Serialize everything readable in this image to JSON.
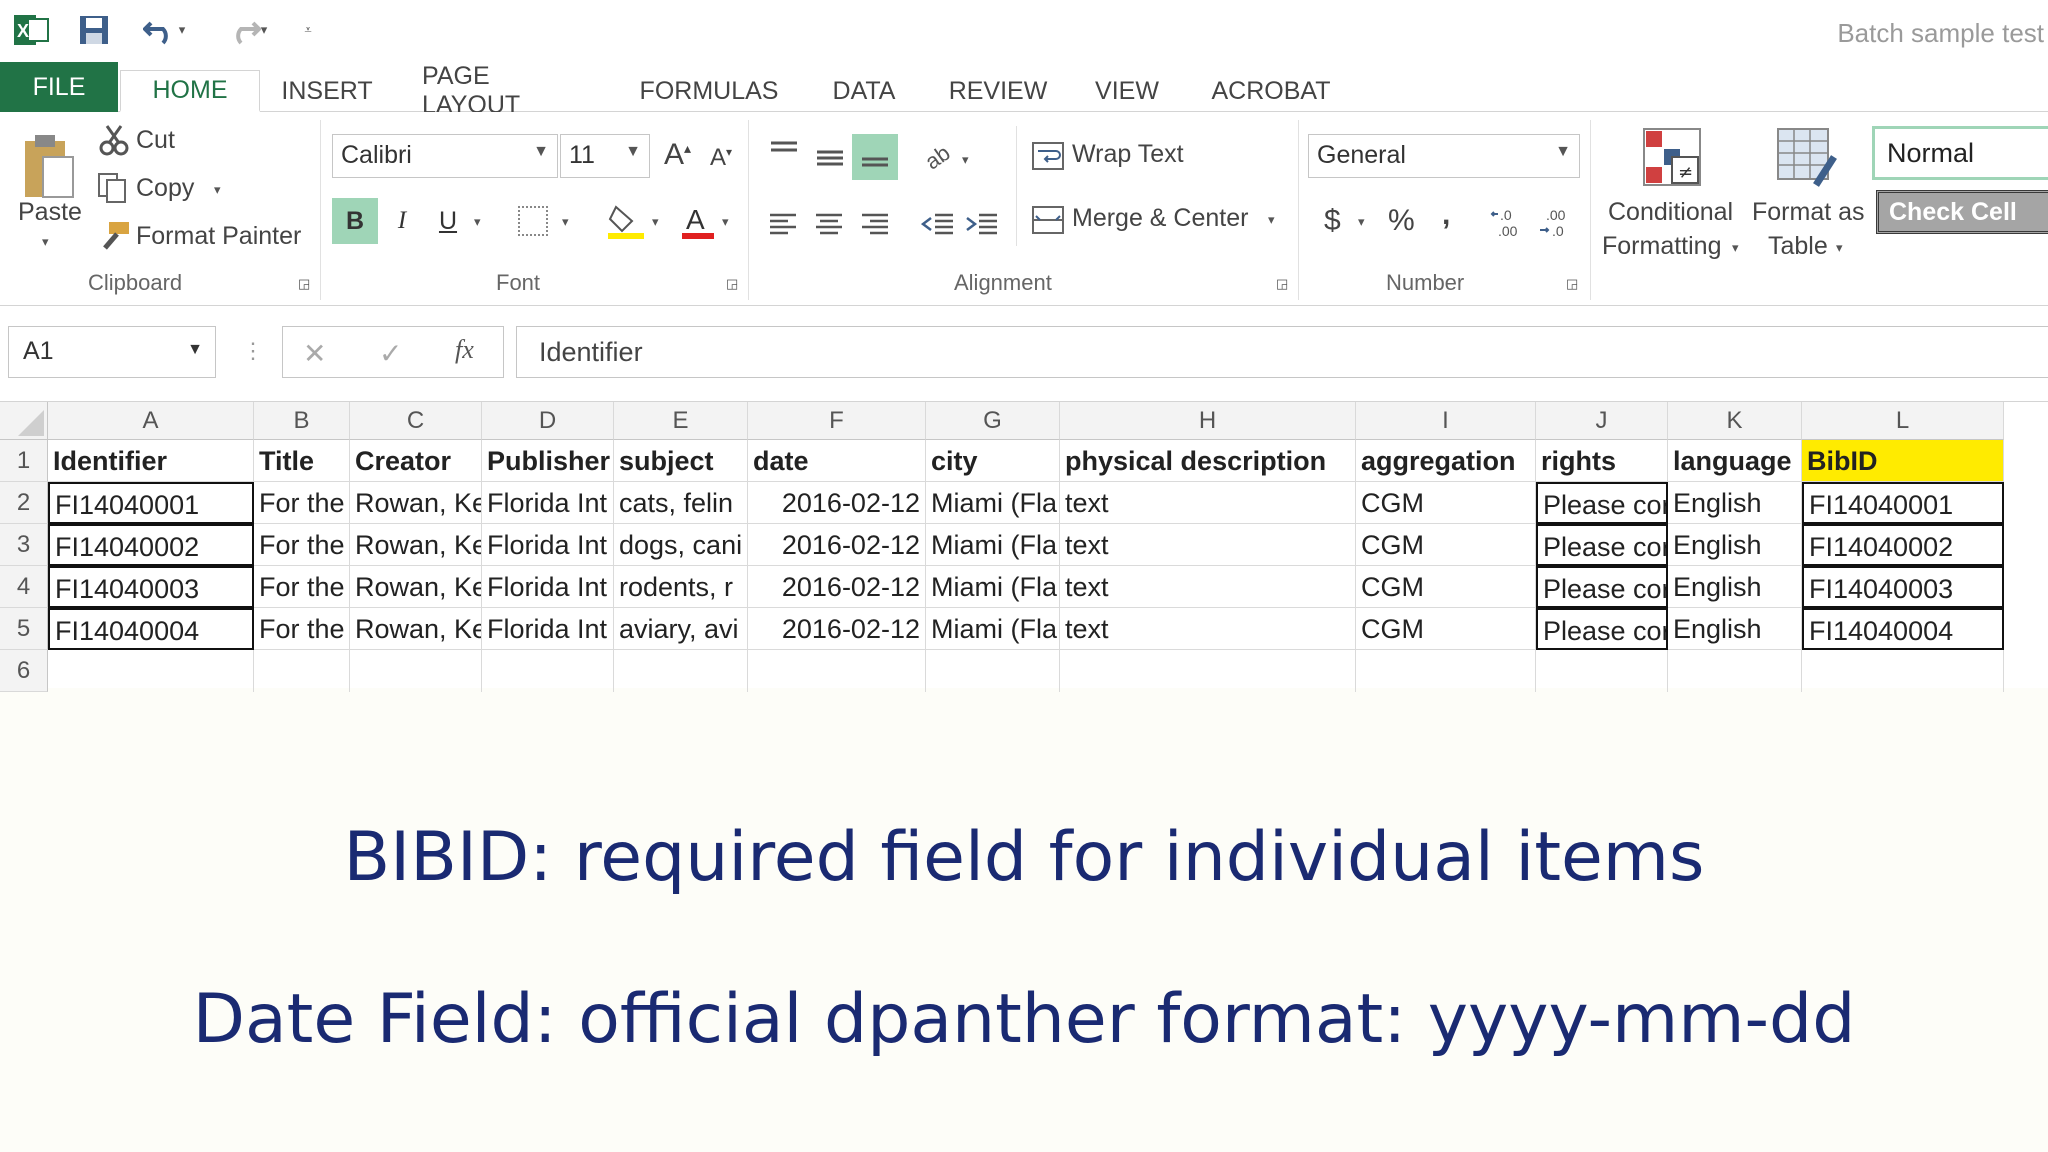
{
  "quick_access": {
    "document_title": "Batch sample test"
  },
  "tabs": [
    "FILE",
    "HOME",
    "INSERT",
    "PAGE LAYOUT",
    "FORMULAS",
    "DATA",
    "REVIEW",
    "VIEW",
    "ACROBAT"
  ],
  "ribbon": {
    "clipboard": {
      "paste": "Paste",
      "cut": "Cut",
      "copy": "Copy",
      "format_painter": "Format Painter",
      "label": "Clipboard"
    },
    "font": {
      "family": "Calibri",
      "size": "11",
      "bold": "B",
      "italic": "I",
      "underline": "U",
      "label": "Font"
    },
    "alignment": {
      "wrap_text": "Wrap Text",
      "merge_center": "Merge & Center",
      "label": "Alignment"
    },
    "number": {
      "format": "General",
      "currency": "$",
      "percent": "%",
      "comma": ",",
      "label": "Number"
    },
    "styles": {
      "conditional_1": "Conditional",
      "conditional_2": "Formatting",
      "format_as_1": "Format as",
      "format_as_2": "Table",
      "normal": "Normal",
      "check_cell": "Check Cell"
    }
  },
  "formula_bar": {
    "name_box": "A1",
    "fx": "fx",
    "value": "Identifier"
  },
  "sheet": {
    "columns": [
      "A",
      "B",
      "C",
      "D",
      "E",
      "F",
      "G",
      "H",
      "I",
      "J",
      "K",
      "L"
    ],
    "row_numbers": [
      "1",
      "2",
      "3",
      "4",
      "5",
      "6"
    ],
    "headers": [
      "Identifier",
      "Title",
      "Creator",
      "Publisher",
      "subject",
      "date",
      "city",
      "physical description",
      "aggregation",
      "rights",
      "language",
      "BibID"
    ],
    "rows": [
      [
        "FI14040001",
        "For the",
        "Rowan, Ke",
        "Florida Int",
        "cats, felin",
        "2016-02-12",
        "Miami (Fla",
        "text",
        "CGM",
        "Please cor",
        "English",
        "FI14040001"
      ],
      [
        "FI14040002",
        "For the",
        "Rowan, Ke",
        "Florida Int",
        "dogs, cani",
        "2016-02-12",
        "Miami (Fla",
        "text",
        "CGM",
        "Please cor",
        "English",
        "FI14040002"
      ],
      [
        "FI14040003",
        "For the",
        "Rowan, Ke",
        "Florida Int",
        "rodents, r",
        "2016-02-12",
        "Miami (Fla",
        "text",
        "CGM",
        "Please cor",
        "English",
        "FI14040003"
      ],
      [
        "FI14040004",
        "For the",
        "Rowan, Ke",
        "Florida Int",
        "aviary, avi",
        "2016-02-12",
        "Miami (Fla",
        "text",
        "CGM",
        "Please cor",
        "English",
        "FI14040004"
      ]
    ]
  },
  "captions": {
    "bibid": "BIBID: required field for individual items",
    "date": "Date Field: official dpanther format: yyyy-mm-dd"
  },
  "colors": {
    "excel_green": "#217346",
    "bibid_highlight": "#ffeb00",
    "caption_blue": "#1a2a72"
  }
}
